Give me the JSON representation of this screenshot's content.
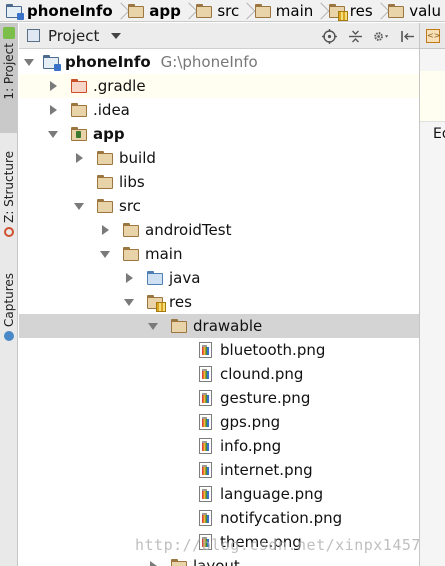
{
  "breadcrumb": [
    {
      "label": "phoneInfo",
      "bold": true,
      "icon": "project-folder-icon"
    },
    {
      "label": "app",
      "bold": true,
      "icon": "module-folder-icon"
    },
    {
      "label": "src",
      "bold": false,
      "icon": "folder-icon"
    },
    {
      "label": "main",
      "bold": false,
      "icon": "folder-icon"
    },
    {
      "label": "res",
      "bold": false,
      "icon": "res-folder-icon"
    },
    {
      "label": "valu",
      "bold": false,
      "icon": "folder-icon"
    }
  ],
  "tool_strip": {
    "project_tab": "1: Project",
    "structure_tab": "Z: Structure",
    "captures_tab": "Captures"
  },
  "panel": {
    "title": "Project"
  },
  "editor": {
    "partial_text": "Ed"
  },
  "tree": {
    "root": {
      "label": "phoneInfo",
      "path": "G:\\phoneInfo"
    },
    "items": [
      {
        "label": ".gradle"
      },
      {
        "label": ".idea"
      },
      {
        "label": "app"
      },
      {
        "label": "build"
      },
      {
        "label": "libs"
      },
      {
        "label": "src"
      },
      {
        "label": "androidTest"
      },
      {
        "label": "main"
      },
      {
        "label": "java"
      },
      {
        "label": "res"
      },
      {
        "label": "drawable"
      },
      {
        "label": "bluetooth.png"
      },
      {
        "label": "clound.png"
      },
      {
        "label": "gesture.png"
      },
      {
        "label": "gps.png"
      },
      {
        "label": "info.png"
      },
      {
        "label": "internet.png"
      },
      {
        "label": "language.png"
      },
      {
        "label": "notifycation.png"
      },
      {
        "label": "theme.png"
      },
      {
        "label": "layout"
      }
    ]
  },
  "watermark": "http://blog.csdn.net/xinpx1457"
}
